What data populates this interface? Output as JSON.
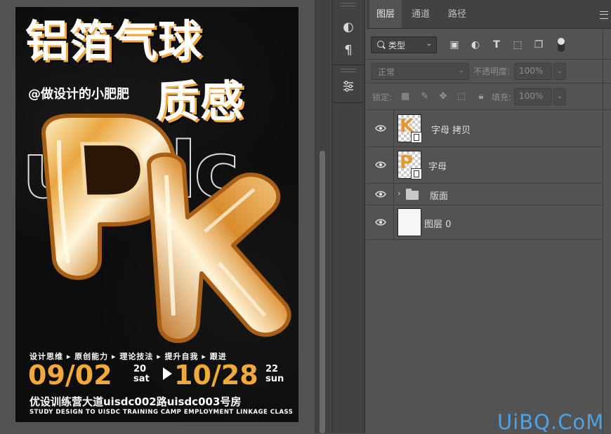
{
  "poster": {
    "title_line1": "铝箔气球",
    "title_line2": "质感",
    "author": "@做设计的小肥肥",
    "outline_text": "uisdc",
    "balloon_letters": "PK",
    "tagline": "设计思维 ▸ 原创能力 ▸ 理论技法 ▸ 提升自我 ▸ 跟进",
    "date_start": "09/02",
    "date_start_day": "20",
    "date_start_weekday": "sat",
    "date_end": "10/28",
    "date_end_day": "22",
    "date_end_weekday": "sun",
    "address": "优设训练营大道uisdc002路uisdc003号房",
    "english": "STUDY DESIGN TO UISDC TRAINING CAMP EMPLOYMENT LINKAGE CLASS"
  },
  "mini_tools": {
    "items": [
      {
        "icon": "adjust-half-circle-icon",
        "glyph": "◐"
      },
      {
        "icon": "paragraph-icon",
        "glyph": "¶"
      },
      {
        "icon": "properties-sliders-icon",
        "glyph": "≡"
      }
    ]
  },
  "layers_panel": {
    "tabs": [
      {
        "label": "图层",
        "active": true
      },
      {
        "label": "通道",
        "active": false
      },
      {
        "label": "路径",
        "active": false
      }
    ],
    "filter": {
      "kind_label": "类型",
      "icons": [
        {
          "name": "filter-pixel-icon",
          "glyph": "▣"
        },
        {
          "name": "filter-adjustment-icon",
          "glyph": "◐"
        },
        {
          "name": "filter-type-icon",
          "glyph": "T"
        },
        {
          "name": "filter-shape-icon",
          "glyph": "⬚"
        },
        {
          "name": "filter-smart-object-icon",
          "glyph": "❐"
        }
      ]
    },
    "blend_mode": "正常",
    "opacity_label": "不透明度:",
    "opacity_value": "100%",
    "lock_label": "锁定:",
    "fill_label": "填充:",
    "fill_value": "100%",
    "layers": [
      {
        "name": "字母 拷贝",
        "type": "smart",
        "thumb_letter": "K"
      },
      {
        "name": "字母",
        "type": "smart",
        "thumb_letter": "P"
      },
      {
        "name": "版面",
        "type": "group"
      },
      {
        "name": "图层 0",
        "type": "pixel"
      }
    ]
  },
  "watermark": "UiBQ.CoM",
  "colors": {
    "accent_gold": "#f2a93b",
    "panel_bg": "#535353",
    "panel_dark": "#424242",
    "watermark_blue": "#4aa3e8"
  }
}
